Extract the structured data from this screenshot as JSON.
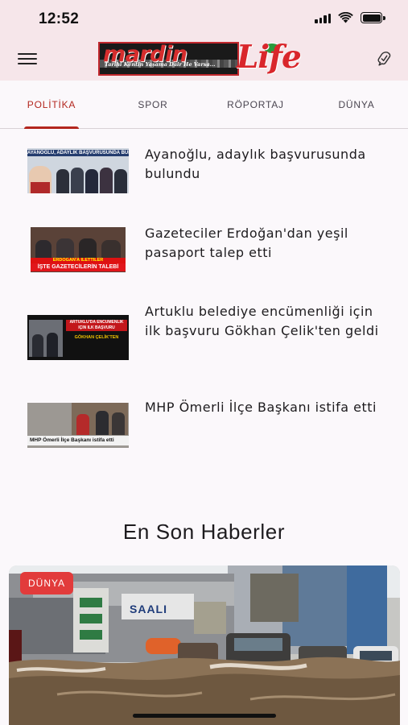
{
  "status_bar": {
    "time": "12:52"
  },
  "app_bar": {
    "logo_main": "mardin",
    "logo_slogan": "Tarihi Kentin Yaşama Dair He Varsa...",
    "logo_life": "Life"
  },
  "tabs": [
    {
      "label": "POLİTİKA",
      "active": true
    },
    {
      "label": "SPOR",
      "active": false
    },
    {
      "label": "RÖPORTAJ",
      "active": false
    },
    {
      "label": "DÜNYA",
      "active": false
    }
  ],
  "news": [
    {
      "title": "Ayanoğlu, adaylık başvurusunda bulundu",
      "thumb_caption": "AYANOĞLU, ADAYLIK BAŞVURUSUNDA BULUNDU"
    },
    {
      "title": "Gazeteciler Erdoğan'dan yeşil pasaport talep etti",
      "thumb_caption_1": "ERDOĞAN'A İLETTİLER",
      "thumb_caption_2": "İŞTE GAZETECİLERİN TALEBİ"
    },
    {
      "title": "Artuklu belediye encümenliği için ilk başvuru Gökhan Çelik'ten geldi",
      "thumb_caption_1": "ARTUKLU'DA ENCÜMENLİK",
      "thumb_caption_2": "İÇİN İLK BAŞVURU",
      "thumb_caption_3": "GÖKHAN ÇELİK'TEN"
    },
    {
      "title": "MHP Ömerli İlçe Başkanı istifa etti",
      "thumb_caption": "MHP Ömerli İlçe Başkanı istifa etti"
    }
  ],
  "section": {
    "title": "En Son Haberler"
  },
  "featured": {
    "badge": "DÜNYA",
    "sign_text": "SAALI"
  },
  "colors": {
    "accent": "#b3261e",
    "app_bar_bg": "#f6e6ea",
    "badge_bg": "#e23b3b"
  },
  "icons": [
    "menu-icon",
    "bookmark-check-icon",
    "wifi-icon",
    "signal-icon",
    "battery-icon"
  ]
}
